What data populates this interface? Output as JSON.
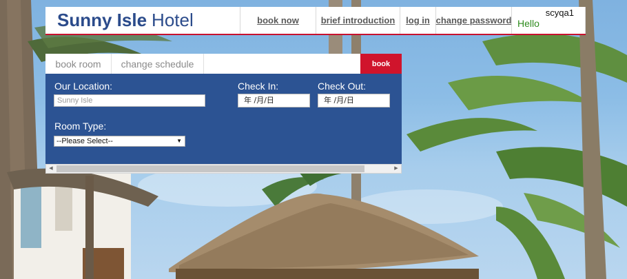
{
  "brand": {
    "strong": "Sunny Isle",
    "light": "Hotel"
  },
  "nav": {
    "book_now": "book now",
    "brief_introduction": "brief introduction",
    "log_in": "log in",
    "change_password": "change password"
  },
  "user": {
    "name": "scyqa1",
    "greeting": "Hello"
  },
  "tabs": {
    "book_room": "book room",
    "change_schedule": "change schedule",
    "book_button": "book"
  },
  "form": {
    "location_label": "Our Location:",
    "location_placeholder": "Sunny Isle",
    "check_in_label": "Check In:",
    "check_in_value": "年 /月/日",
    "check_out_label": "Check Out:",
    "check_out_value": "年 /月/日",
    "room_type_label": "Room Type:",
    "room_type_selected": "--Please Select--"
  },
  "scrollbar": {
    "left_icon": "arrow-left-icon",
    "right_icon": "arrow-right-icon"
  },
  "colors": {
    "brand_blue": "#2b4b8b",
    "panel_blue": "#2c5393",
    "accent_red": "#d0142c",
    "hello_green": "#2e8b1d"
  }
}
